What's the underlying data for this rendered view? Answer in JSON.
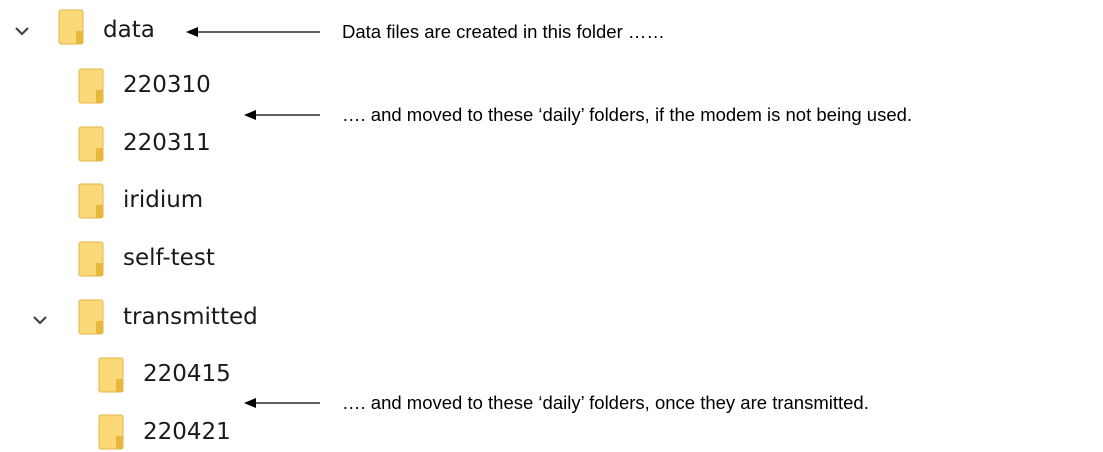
{
  "tree": {
    "items": [
      {
        "label": "data",
        "icon": "folder-icon",
        "expanded": true
      },
      {
        "label": "220310",
        "icon": "folder-icon"
      },
      {
        "label": "220311",
        "icon": "folder-icon"
      },
      {
        "label": "iridium",
        "icon": "folder-icon"
      },
      {
        "label": "self-test",
        "icon": "folder-icon"
      },
      {
        "label": "transmitted",
        "icon": "folder-icon",
        "expanded": true
      },
      {
        "label": "220415",
        "icon": "folder-icon"
      },
      {
        "label": "220421",
        "icon": "folder-icon"
      }
    ]
  },
  "annotations": {
    "data_folder": "Data files are created in this folder ……",
    "daily_folders": "…. and moved to these ‘daily’ folders, if the modem is not being used.",
    "transmitted_folders": "…. and moved to these ‘daily’ folders, once they are transmitted."
  },
  "colors": {
    "folder_fill": "#fbd978",
    "folder_shadow": "#e8b83c",
    "text": "#1a1a1a",
    "arrow": "#000000"
  }
}
